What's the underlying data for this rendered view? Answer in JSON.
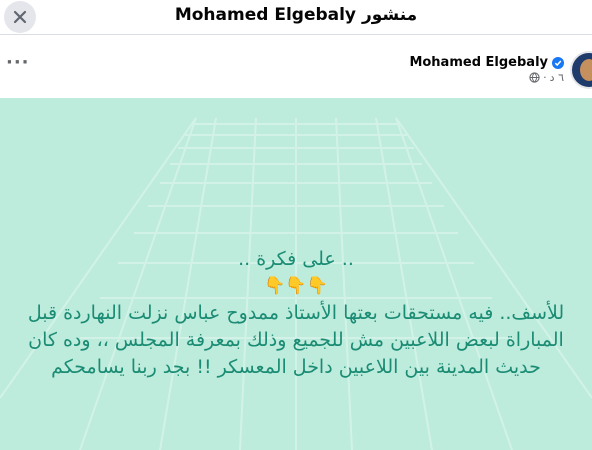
{
  "header": {
    "title": "منشور Mohamed Elgebaly"
  },
  "post": {
    "author": "Mohamed Elgebaly",
    "time": "٦ د",
    "body": {
      "line1": ".. على فكرة ..",
      "line2": "👇👇👇",
      "line3": "للأسف.. فيه مستحقات بعتها الأستاذ ممدوح عباس نزلت النهاردة قبل",
      "line4": "المباراة لبعض اللاعبين مش للجميع وذلك بمعرفة المجلس ،، وده كان",
      "line5": "حديث المدينة بين اللاعبين داخل المعسكر !! بجد ربنا يسامحكم"
    }
  },
  "colors": {
    "background": "#bdebdc",
    "text": "#1b8c74",
    "grid": "#d6f4ea"
  }
}
